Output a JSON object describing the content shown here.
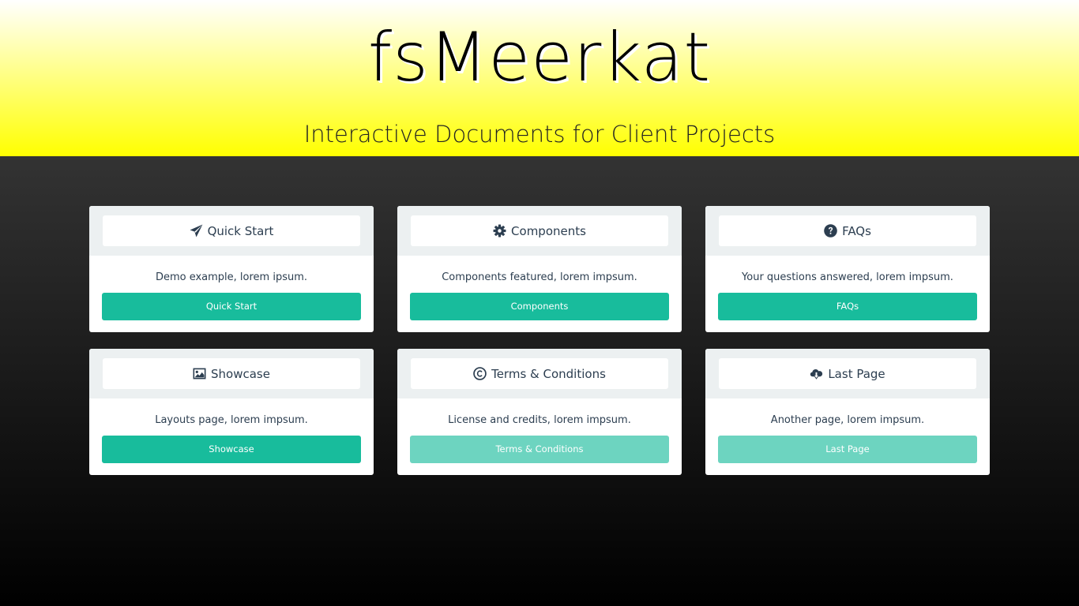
{
  "hero": {
    "title": "fsMeerkat",
    "subtitle": "Interactive Documents for Client Projects"
  },
  "colors": {
    "accent": "#18bc9c",
    "accent_disabled": "#6dd4c0",
    "header_top": "#ffffff",
    "header_bottom": "#ffff00",
    "text_dark": "#2c3e50"
  },
  "cards": [
    {
      "title": "Quick Start",
      "icon": "paper-plane-icon",
      "description": "Demo example, lorem ipsum.",
      "button_label": "Quick Start"
    },
    {
      "title": "Components",
      "icon": "gear-icon",
      "description": "Components featured, lorem impsum.",
      "button_label": "Components"
    },
    {
      "title": "FAQs",
      "icon": "question-circle-icon",
      "description": "Your questions answered, lorem impsum.",
      "button_label": "FAQs"
    },
    {
      "title": "Showcase",
      "icon": "image-icon",
      "description": "Layouts page, lorem impsum.",
      "button_label": "Showcase"
    },
    {
      "title": "Terms & Conditions",
      "icon": "copyright-icon",
      "description": "License and credits, lorem impsum.",
      "button_label": "Terms & Conditions"
    },
    {
      "title": "Last Page",
      "icon": "cloud-download-icon",
      "description": "Another page, lorem impsum.",
      "button_label": "Last Page"
    }
  ]
}
